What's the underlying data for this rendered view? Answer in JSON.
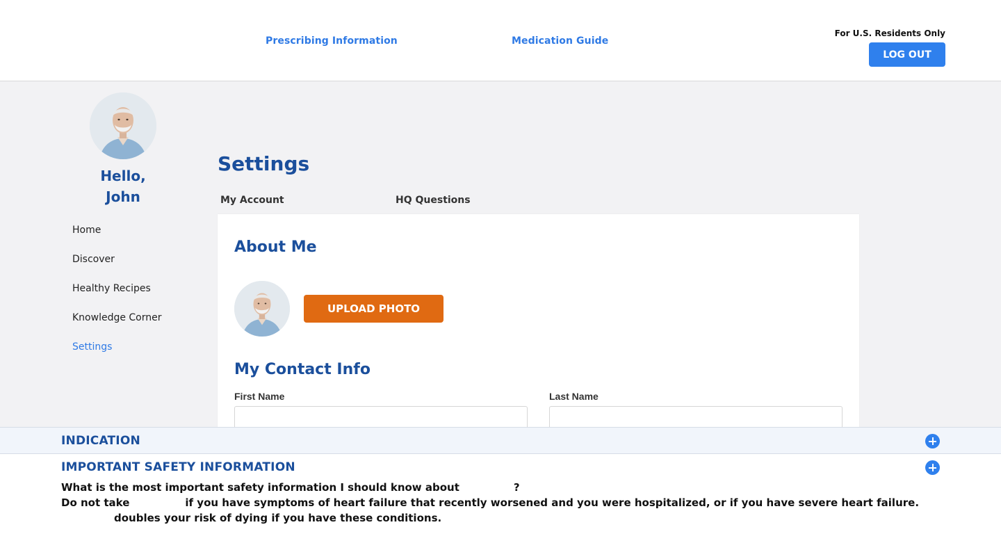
{
  "header": {
    "links": [
      "Prescribing Information",
      "Medication Guide"
    ],
    "residents_note": "For U.S. Residents Only",
    "logout_label": "LOG OUT"
  },
  "sidebar": {
    "greeting_line1": "Hello,",
    "greeting_line2": "John",
    "items": [
      {
        "label": "Home"
      },
      {
        "label": "Discover"
      },
      {
        "label": "Healthy Recipes"
      },
      {
        "label": "Knowledge Corner"
      },
      {
        "label": "Settings",
        "active": true
      }
    ]
  },
  "main": {
    "title": "Settings",
    "tabs": [
      "My Account",
      "HQ Questions"
    ],
    "about_heading": "About Me",
    "upload_label": "UPLOAD PHOTO",
    "contact_heading": "My Contact Info",
    "first_name_label": "First Name",
    "first_name_value": "",
    "last_name_label": "Last Name",
    "last_name_value": ""
  },
  "isi": {
    "indication_title": "INDICATION",
    "safety_title": "IMPORTANT SAFETY INFORMATION",
    "question_prefix": "What is the most important safety information I should know about",
    "question_suffix": "?",
    "line1_prefix": "Do not take",
    "line1_rest": "if you have symptoms of heart failure that recently worsened and you were hospitalized, or if you have severe heart failure.",
    "line2": "doubles your risk of dying if you have these conditions."
  },
  "colors": {
    "brand_blue": "#1b4f9c",
    "link_blue": "#2f7ae5",
    "button_blue": "#2f80ed",
    "upload_orange": "#e06a12",
    "background_gray": "#f2f2f4"
  },
  "icons": [
    "profile-photo",
    "plus-circle-icon"
  ]
}
